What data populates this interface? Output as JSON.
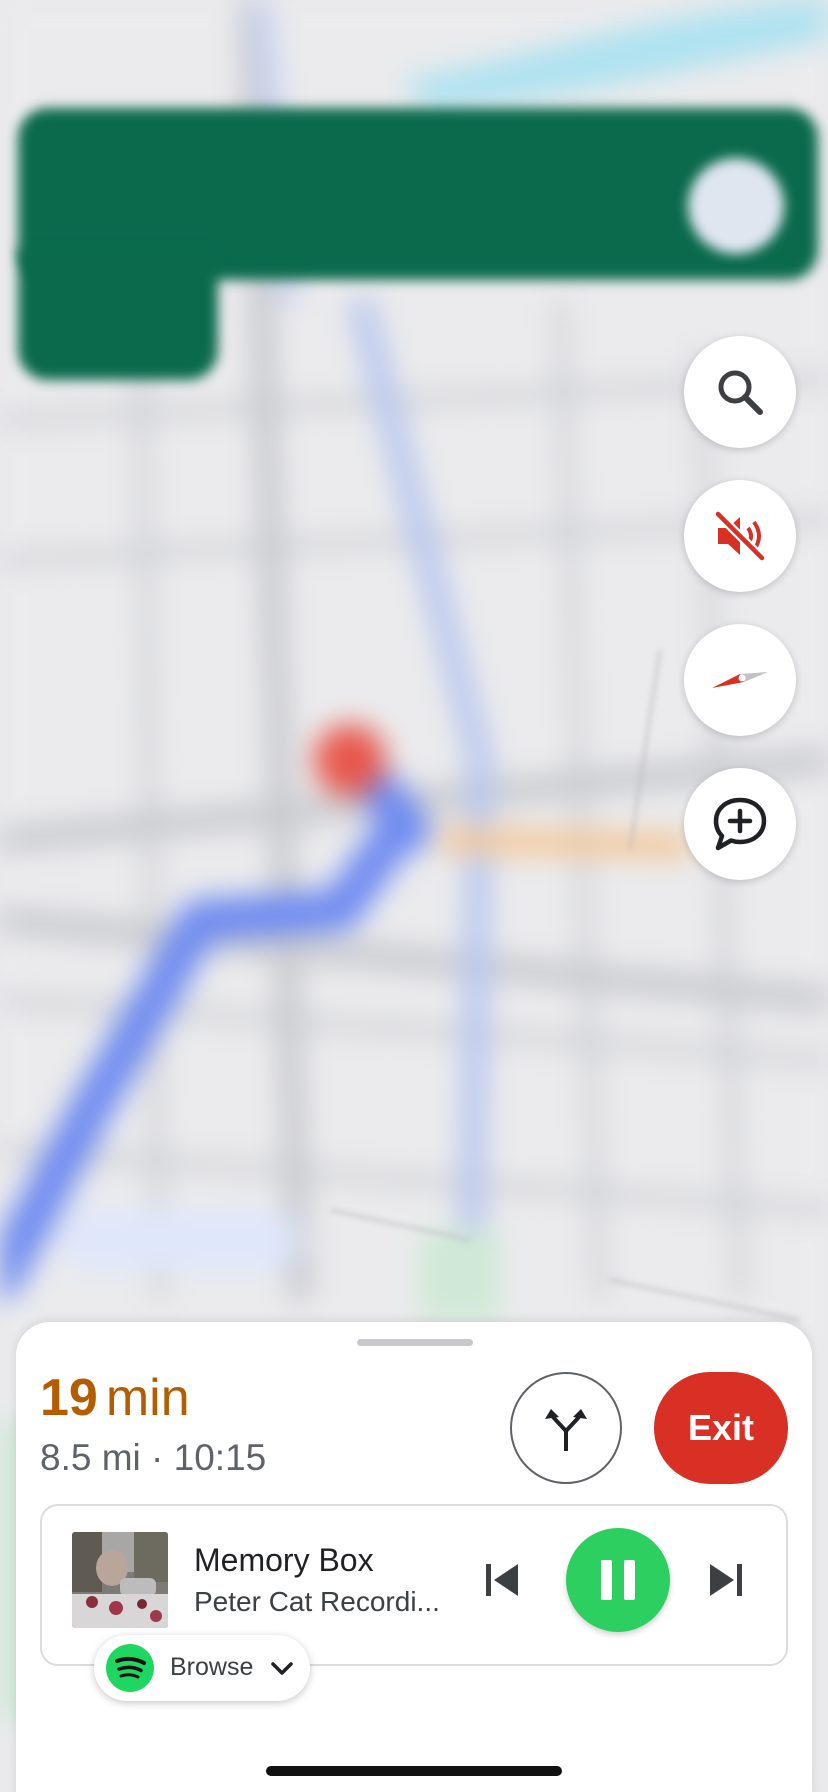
{
  "nav": {
    "search_icon": "search-icon",
    "mute_icon": "sound-off-icon",
    "compass_icon": "compass-icon",
    "report_icon": "add-report-icon",
    "accent_red": "#d93025",
    "banner_green": "#0b6a4c"
  },
  "trip": {
    "eta_value": "19",
    "eta_unit": "min",
    "distance_time": "8.5 mi · 10:15",
    "exit_label": "Exit",
    "eta_color": "#b35c00"
  },
  "media": {
    "title": "Memory Box",
    "artist": "Peter Cat Recordi...",
    "browse_label": "Browse",
    "play_color": "#2dd060",
    "service_icon": "spotify-icon"
  }
}
